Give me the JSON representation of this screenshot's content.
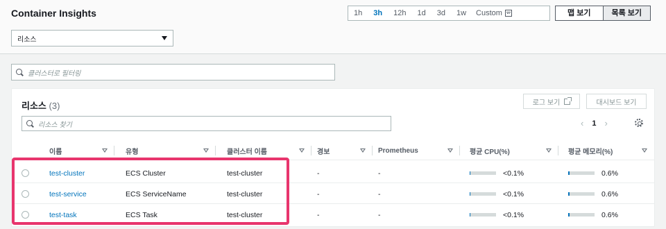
{
  "header": {
    "title": "Container Insights",
    "time_ranges": [
      "1h",
      "3h",
      "12h",
      "1d",
      "3d",
      "1w"
    ],
    "time_range_selected": "3h",
    "custom_label": "Custom",
    "view_map_label": "맵 보기",
    "view_list_label": "목록 보기",
    "resource_select_value": "리소스"
  },
  "filter": {
    "placeholder": "클러스터로 필터링"
  },
  "panel": {
    "title": "리소스",
    "count": "(3)",
    "log_button": "로그 보기",
    "dashboard_button": "대시보드 보기",
    "search_placeholder": "리소스 찾기",
    "page": "1",
    "prev_arrow": "‹",
    "next_arrow": "›"
  },
  "table": {
    "columns": [
      "이름",
      "유형",
      "클러스터 이름",
      "경보",
      "Prometheus",
      "평균 CPU(%)",
      "평균 메모리(%)"
    ],
    "rows": [
      {
        "name": "test-cluster",
        "type": "ECS Cluster",
        "cluster": "test-cluster",
        "alarm": "-",
        "prometheus": "-",
        "cpu": "<0.1%",
        "cpu_level": 0.03,
        "memory": "0.6%",
        "memory_level": 0.05
      },
      {
        "name": "test-service",
        "type": "ECS ServiceName",
        "cluster": "test-cluster",
        "alarm": "-",
        "prometheus": "-",
        "cpu": "<0.1%",
        "cpu_level": 0.03,
        "memory": "0.6%",
        "memory_level": 0.05
      },
      {
        "name": "test-task",
        "type": "ECS Task",
        "cluster": "test-cluster",
        "alarm": "-",
        "prometheus": "-",
        "cpu": "<0.1%",
        "cpu_level": 0.03,
        "memory": "0.6%",
        "memory_level": 0.05
      }
    ]
  },
  "colors": {
    "link": "#0073bb",
    "highlight": "#e8356d",
    "bar_fill": "#0073bb"
  }
}
